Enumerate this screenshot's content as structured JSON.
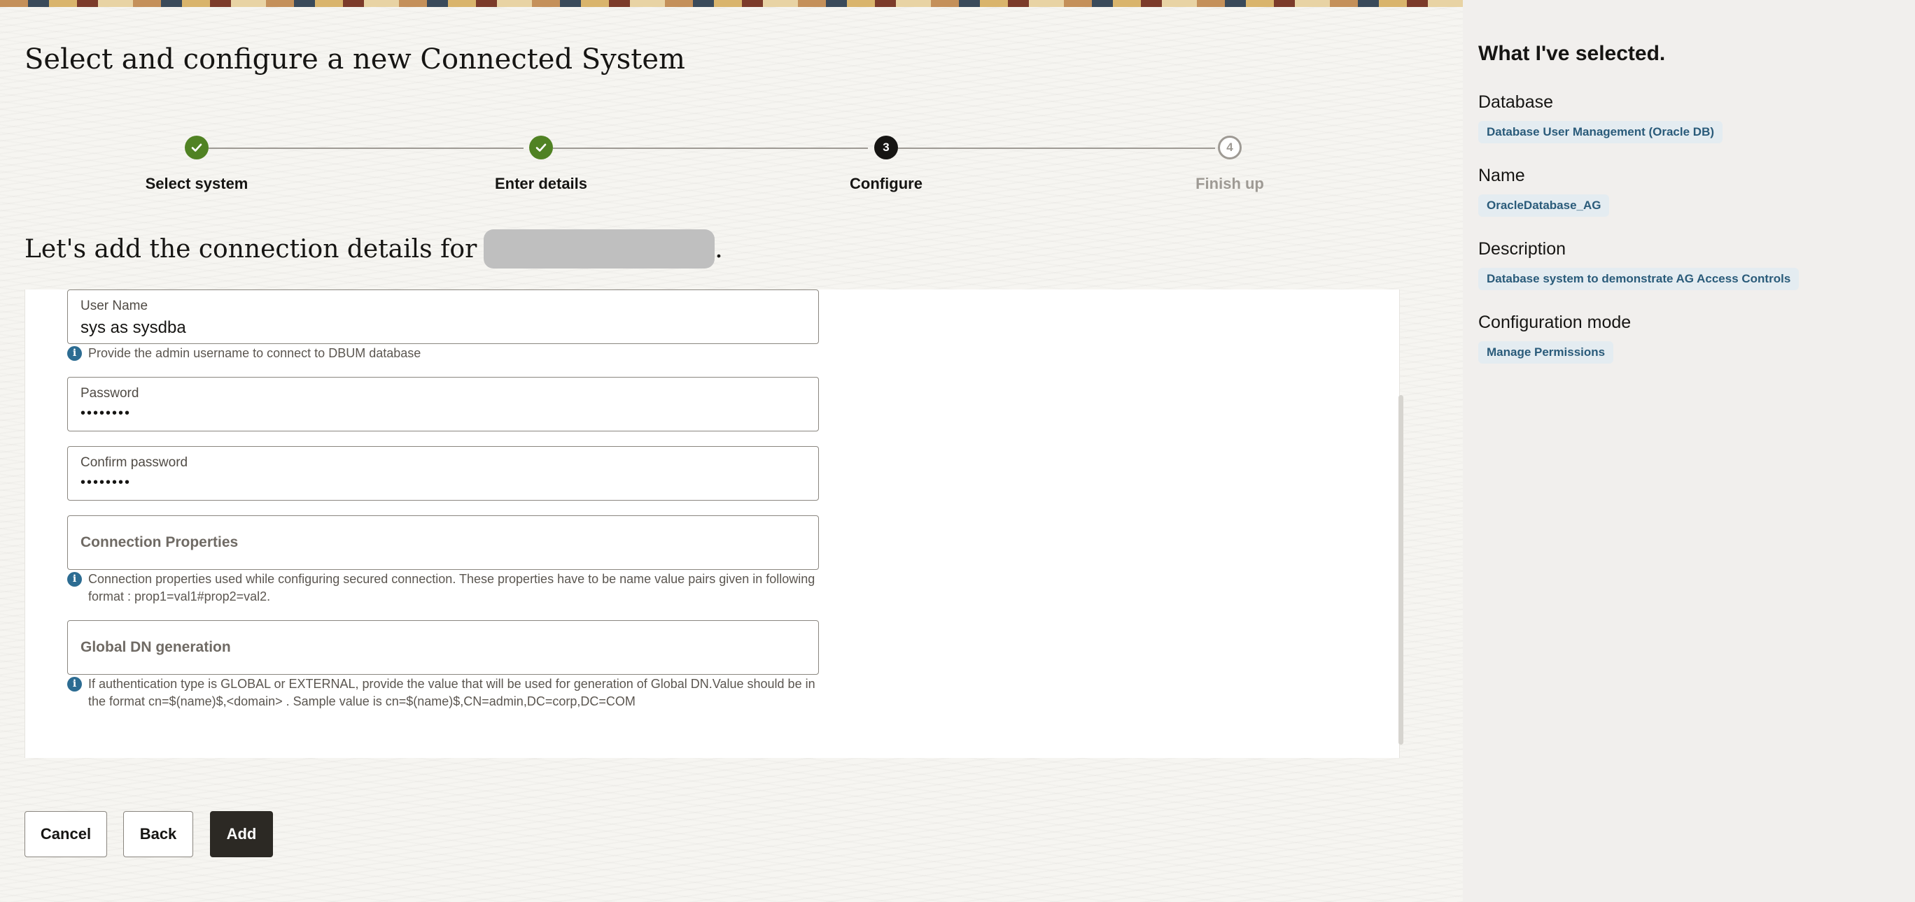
{
  "page_title": "Select and configure a new Connected System",
  "steps": [
    {
      "number": "1",
      "label": "Select system",
      "state": "done"
    },
    {
      "number": "2",
      "label": "Enter details",
      "state": "done"
    },
    {
      "number": "3",
      "label": "Configure",
      "state": "current"
    },
    {
      "number": "4",
      "label": "Finish up",
      "state": "todo"
    }
  ],
  "subheading": {
    "text": "Let's add the connection details for",
    "suffix": "."
  },
  "form": {
    "user_name": {
      "label": "User Name",
      "value": "sys as sysdba",
      "help": "Provide the admin username to connect to DBUM database"
    },
    "password": {
      "label": "Password",
      "value": "••••••••"
    },
    "confirm_password": {
      "label": "Confirm password",
      "value": "••••••••"
    },
    "connection_properties": {
      "label": "Connection Properties",
      "help": "Connection properties used while configuring secured connection. These properties have to be name value pairs given in following format : prop1=val1#prop2=val2."
    },
    "global_dn": {
      "label": "Global DN generation",
      "help": "If authentication type is GLOBAL or EXTERNAL, provide the value that will be used for generation of Global DN.Value should be in the format cn=$(name)$,<domain> . Sample value is cn=$(name)$,CN=admin,DC=corp,DC=COM"
    }
  },
  "buttons": {
    "cancel": "Cancel",
    "back": "Back",
    "add": "Add"
  },
  "summary": {
    "title": "What I've selected.",
    "sections": [
      {
        "label": "Database",
        "value": "Database User Management (Oracle DB)"
      },
      {
        "label": "Name",
        "value": "OracleDatabase_AG"
      },
      {
        "label": "Description",
        "value": "Database system to demonstrate AG Access Controls"
      },
      {
        "label": "Configuration mode",
        "value": "Manage Permissions"
      }
    ]
  },
  "colors": {
    "step_done": "#508223",
    "step_current": "#161513",
    "primary_button": "#2c2924",
    "info_icon": "#2c6c92",
    "chip_bg": "#e4ecf1",
    "chip_text": "#2a5b7a"
  },
  "icons": {
    "step_done": "check-icon",
    "help": "info-icon"
  }
}
